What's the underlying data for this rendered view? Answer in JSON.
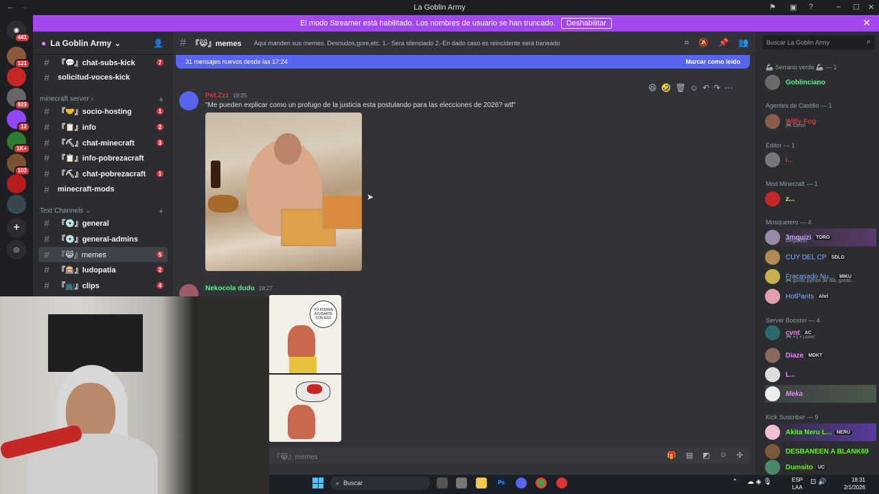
{
  "window": {
    "title": "La Goblin Army"
  },
  "banner": {
    "text": "El modo Streamer está habilitado. Los nombres de usuario se han truncado.",
    "button": "Deshabilitar"
  },
  "servers": [
    {
      "badge": "441"
    },
    {
      "badge": "121"
    },
    {
      "badge": ""
    },
    {
      "badge": "929"
    },
    {
      "badge": "12"
    },
    {
      "badge": "1K+"
    },
    {
      "badge": "103"
    },
    {
      "badge": ""
    },
    {
      "badge": ""
    }
  ],
  "sidebar": {
    "server_name": "La Goblin Army",
    "channels_top": [
      {
        "name": "『💬』chat-subs-kick",
        "count": "7"
      },
      {
        "name": "solicitud-voces-kick",
        "count": ""
      }
    ],
    "category1": "minecraft server",
    "channels_mc": [
      {
        "name": "『🤝』socio-hosting",
        "count": "1"
      },
      {
        "name": "『📋』info",
        "count": "2"
      },
      {
        "name": "『⛏』chat-minecraft",
        "count": "3"
      },
      {
        "name": "『📋』info-pobrezacraft",
        "count": ""
      },
      {
        "name": "『⛏』chat-pobrezacraft",
        "count": "1"
      },
      {
        "name": "minecraft-mods",
        "count": ""
      }
    ],
    "category2": "Text Channels",
    "channels_text": [
      {
        "name": "『💿』general",
        "count": ""
      },
      {
        "name": "『💿』general-admins",
        "count": ""
      },
      {
        "name": "『😹』memes",
        "count": "5"
      },
      {
        "name": "『🎰』ludopatia",
        "count": "2"
      },
      {
        "name": "『📺』clips",
        "count": "4"
      }
    ]
  },
  "chat": {
    "channel": "『😹』memes",
    "topic": "Aqui manden sus memes. Desnudos,gore,etc. 1.- Sera silenciado 2.-En dado caso es reincidente sera baneado",
    "new_messages": "31 mensajes nuevos desde las 17:24",
    "mark_read": "Marcar como leído",
    "messages": [
      {
        "author": "Pet.Zzz",
        "time": "18:25",
        "text": "\"Me pueden explicar como un profugo de la justicia esta postulando para las elecciones de 2026? wtf\"",
        "color": "#da373c"
      },
      {
        "author": "Nekocola dudu",
        "time": "18:27",
        "text": "",
        "color": "#57f287"
      }
    ],
    "comic_text": "YO PODRÍA AYUDARTE CON ESO",
    "input_placeholder": "『😹』memes"
  },
  "members": {
    "search_placeholder": "Buscar La Goblin Army",
    "groups": [
      {
        "role": "🦾 Serrano verde 🦾 — 1",
        "members": [
          {
            "name": "Goblinciano",
            "color": "#57f287",
            "sub": "",
            "tag": ""
          }
        ]
      },
      {
        "role": "Agentes de Castillo — 1",
        "members": [
          {
            "name": "Willy Fog",
            "color": "#da373c",
            "sub": "🎮 Citron",
            "tag": ""
          }
        ]
      },
      {
        "role": "Editor — 1",
        "members": [
          {
            "name": "i...",
            "color": "#da373c",
            "sub": "",
            "tag": ""
          }
        ]
      },
      {
        "role": "Mod Minecraft — 1",
        "members": [
          {
            "name": "z...",
            "color": "#fee75c",
            "sub": "",
            "tag": ""
          }
        ]
      },
      {
        "role": "Mosquetero — 4",
        "members": [
          {
            "name": "3mquizi",
            "color": "#c9a7ff",
            "sub": "Megadeth",
            "tag": "TORO"
          },
          {
            "name": "CUY DEL CP",
            "color": "#7fb3ff",
            "sub": "",
            "tag": "SDLG"
          },
          {
            "name": "Fracasado Nu...",
            "color": "#7fb3ff",
            "sub": "🎮 gordo python de día, gordo...",
            "tag": "MIKU"
          },
          {
            "name": "HotPants",
            "color": "#7fb3ff",
            "sub": "",
            "tag": "Ahri"
          }
        ]
      },
      {
        "role": "Server Booster — 4",
        "members": [
          {
            "name": "cvnt",
            "color": "#f47fff",
            "sub": "🎮 +1 • Loser",
            "tag": "AC"
          },
          {
            "name": "Diaze",
            "color": "#f47fff",
            "sub": "",
            "tag": "MDKT"
          },
          {
            "name": "L...",
            "color": "#f47fff",
            "sub": "",
            "tag": ""
          },
          {
            "name": "Meka",
            "color": "#f47fff",
            "sub": "",
            "tag": ""
          }
        ]
      },
      {
        "role": "Kick Suscriber — 9",
        "members": [
          {
            "name": "Akita Neru L...",
            "color": "#53fc18",
            "sub": "",
            "tag": "NERU"
          },
          {
            "name": "DESBANEEN A BLANK69",
            "color": "#53fc18",
            "sub": "",
            "tag": ""
          },
          {
            "name": "Dumsito",
            "color": "#53fc18",
            "sub": "",
            "tag": "UC"
          }
        ]
      }
    ]
  },
  "taskbar": {
    "search": "Buscar",
    "lang1": "ESP",
    "lang2": "LAA",
    "time": "18:31",
    "date": "2/1/2026"
  },
  "colors": {
    "accent": "#5865f2",
    "banner": "#a348f0",
    "danger": "#da373c"
  }
}
